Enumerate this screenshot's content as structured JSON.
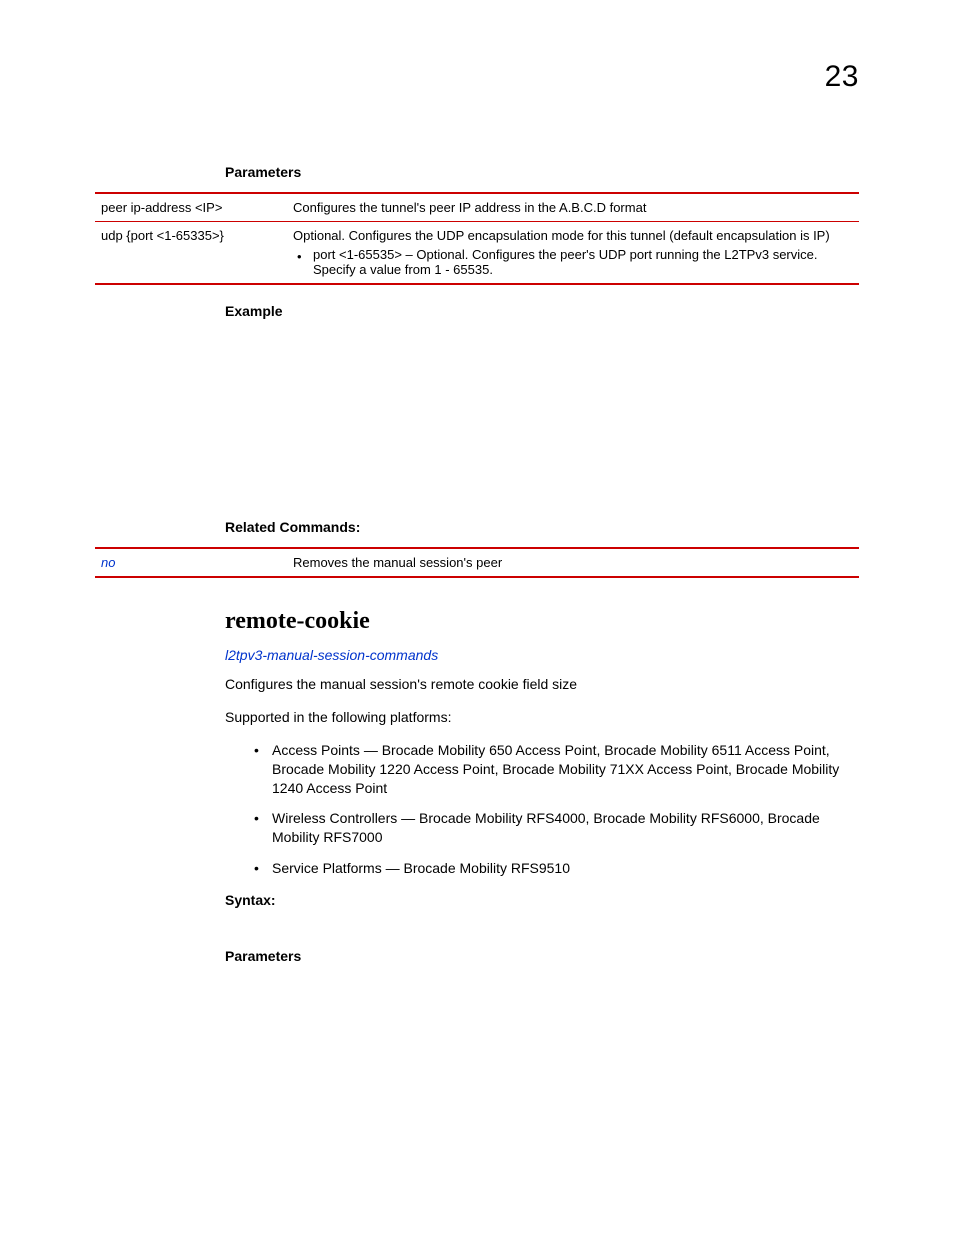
{
  "page_number": "23",
  "parameters_heading": "Parameters",
  "param_table": {
    "row1": {
      "left": "peer ip-address <IP>",
      "right": "Configures the tunnel's peer IP address in the A.B.C.D format"
    },
    "row2": {
      "left": "udp {port <1-65335>}",
      "right_line1": "Optional. Configures the UDP encapsulation mode for this tunnel (default encapsulation is IP)",
      "right_bullet": "port <1-65535> – Optional. Configures the peer's UDP port running the L2TPv3 service. Specify a value from 1 - 65535."
    }
  },
  "example_heading": "Example",
  "related_heading": "Related Commands:",
  "related_table": {
    "left": "no",
    "right": "Removes the manual session's peer"
  },
  "command_title": "remote-cookie",
  "command_link": "l2tpv3-manual-session-commands",
  "desc1": "Configures the manual session's remote cookie field size",
  "desc2": "Supported in the following platforms:",
  "platforms": {
    "p1": "Access Points — Brocade Mobility 650 Access Point, Brocade Mobility 6511 Access Point, Brocade Mobility 1220 Access Point, Brocade Mobility 71XX Access Point, Brocade Mobility 1240 Access Point",
    "p2": "Wireless Controllers — Brocade Mobility RFS4000, Brocade Mobility RFS6000, Brocade Mobility RFS7000",
    "p3": "Service Platforms — Brocade Mobility RFS9510"
  },
  "syntax_heading": "Syntax:",
  "parameters2_heading": "Parameters"
}
